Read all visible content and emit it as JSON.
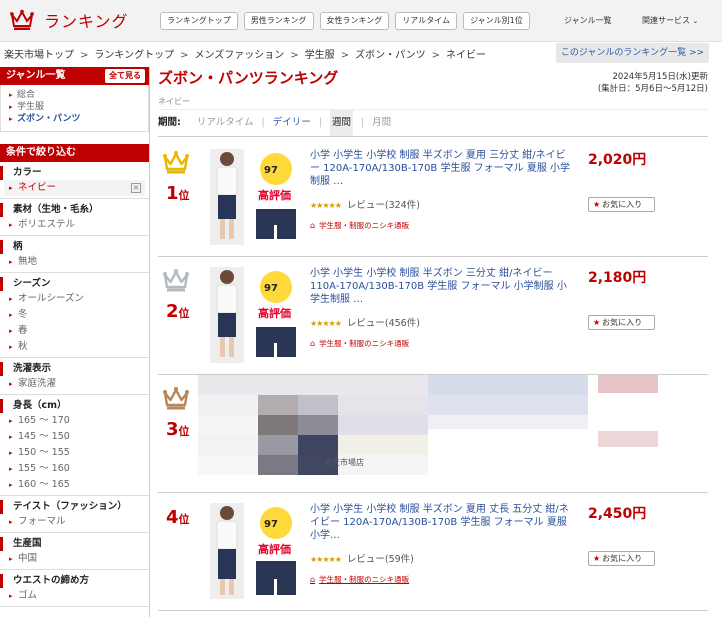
{
  "header": {
    "logo_text": "ランキング",
    "nav": [
      "ランキングトップ",
      "男性ランキング",
      "女性ランキング",
      "リアルタイム",
      "ジャンル別1位"
    ],
    "genre_list_link": "ジャンル一覧",
    "related_services": "関連サービス"
  },
  "breadcrumb": [
    "楽天市場トップ",
    "ランキングトップ",
    "メンズファッション",
    "学生服",
    "ズボン・パンツ",
    "ネイビー"
  ],
  "genre_ranking_link": "このジャンルのランキング一覧 >>",
  "sidebar": {
    "genre_heading": "ジャンル一覧",
    "show_all": "全て見る",
    "genres": [
      {
        "label": "総合",
        "active": false
      },
      {
        "label": "学生服",
        "active": false
      },
      {
        "label": "ズボン・パンツ",
        "active": true
      }
    ],
    "filter_heading": "条件で絞り込む",
    "filters": [
      {
        "title": "カラー",
        "values": [
          "ネイビー"
        ],
        "selected": true
      },
      {
        "title": "素材（生地・毛糸）",
        "values": [
          "ポリエステル"
        ]
      },
      {
        "title": "柄",
        "values": [
          "無地"
        ]
      },
      {
        "title": "シーズン",
        "values": [
          "オールシーズン",
          "冬",
          "春",
          "秋"
        ]
      },
      {
        "title": "洗濯表示",
        "values": [
          "家庭洗濯"
        ]
      },
      {
        "title": "身長（cm）",
        "values": [
          "165 ～ 170",
          "145 ～ 150",
          "150 ～ 155",
          "155 ～ 160",
          "160 ～ 165"
        ]
      },
      {
        "title": "テイスト（ファッション）",
        "values": [
          "フォーマル"
        ]
      },
      {
        "title": "生産国",
        "values": [
          "中国"
        ]
      },
      {
        "title": "ウエストの締め方",
        "values": [
          "ゴム"
        ]
      }
    ]
  },
  "main": {
    "title": "ズボン・パンツランキング",
    "sub_genre": "ネイビー",
    "date_updated": "2024年5月15日(水)更新",
    "date_range": "(集計日：5月6日～5月12日)",
    "period_label": "期間:",
    "periods": [
      {
        "label": "リアルタイム",
        "state": "disabled"
      },
      {
        "label": "デイリー",
        "state": "link"
      },
      {
        "label": "週間",
        "state": "current"
      },
      {
        "label": "月間",
        "state": "disabled"
      }
    ],
    "fav_label": "お気に入り",
    "rank_suffix": "位",
    "items": [
      {
        "rank": "1",
        "crown": "gold",
        "title": "小学 小学生 小学校 制服 半ズボン 夏用 三分丈 紺/ネイビー 120A-170A/130B-170B 学生服 フォーマル 夏服 小学制服 …",
        "price": "2,020円",
        "review": "レビュー(324件)",
        "shop": "学生服・制服のニシキ通販",
        "thumb_badge": "97",
        "thumb_text": "高評価"
      },
      {
        "rank": "2",
        "crown": "silver",
        "title": "小学 小学生 小学校 制服 半ズボン 三分丈 紺/ネイビー 110A-170A/130B-170B 学生服 フォーマル 小学制服 小学生制服 …",
        "price": "2,180円",
        "review": "レビュー(456件)",
        "shop": "学生服・制服のニシキ通販",
        "thumb_badge": "97",
        "thumb_text": "高評価"
      },
      {
        "rank": "3",
        "crown": "bronze",
        "shop_partial": "楽天市場店"
      },
      {
        "rank": "4",
        "crown": "none",
        "title": "小学 小学生 小学校 制服 半ズボン 夏用 丈長 五分丈 紺/ネイビー 120A-170A/130B-170B 学生服 フォーマル 夏服 小学…",
        "price": "2,450円",
        "review": "レビュー(59件)",
        "shop": "学生服・制服のニシキ通販",
        "thumb_badge": "97",
        "thumb_text": "高評価"
      }
    ]
  },
  "colors": {
    "brand_red": "#bf0000",
    "link_blue": "#2a4f9b",
    "gold": "#e6b800",
    "silver": "#b5b9c4",
    "bronze": "#b8865a"
  }
}
